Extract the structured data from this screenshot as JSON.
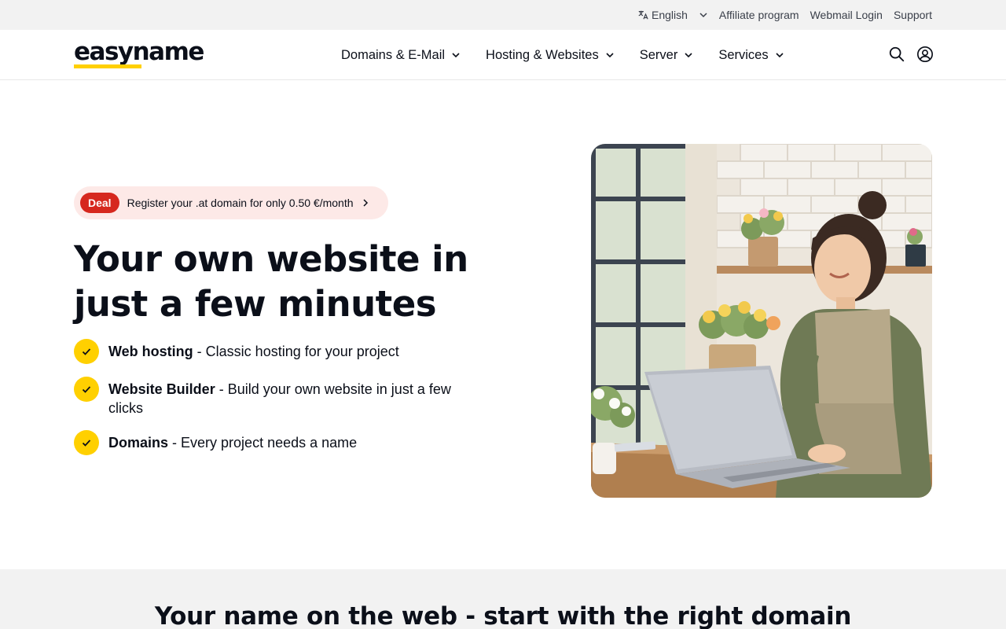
{
  "topbar": {
    "language": "English",
    "links": [
      "Affiliate program",
      "Webmail Login",
      "Support"
    ]
  },
  "header": {
    "logo": "easyname",
    "nav": [
      "Domains & E-Mail",
      "Hosting & Websites",
      "Server",
      "Services"
    ],
    "icons": [
      "search-icon",
      "account-icon"
    ]
  },
  "hero": {
    "deal_badge": "Deal",
    "deal_text": "Register your .at domain for only 0.50 €/month",
    "title": "Your own website in just a few minutes",
    "features": [
      {
        "name": "Web hosting",
        "desc": " - Classic hosting for your project"
      },
      {
        "name": "Website Builder",
        "desc": " - Build your own website in just a few clicks"
      },
      {
        "name": "Domains",
        "desc": " - Every project needs a name"
      }
    ]
  },
  "section2": {
    "title": "Your name on the web - start with the right domain"
  },
  "colors": {
    "accent_yellow": "#ffd000",
    "deal_red": "#d6281e",
    "deal_bg": "#fde9e7",
    "topbar_bg": "#f2f2f2"
  }
}
